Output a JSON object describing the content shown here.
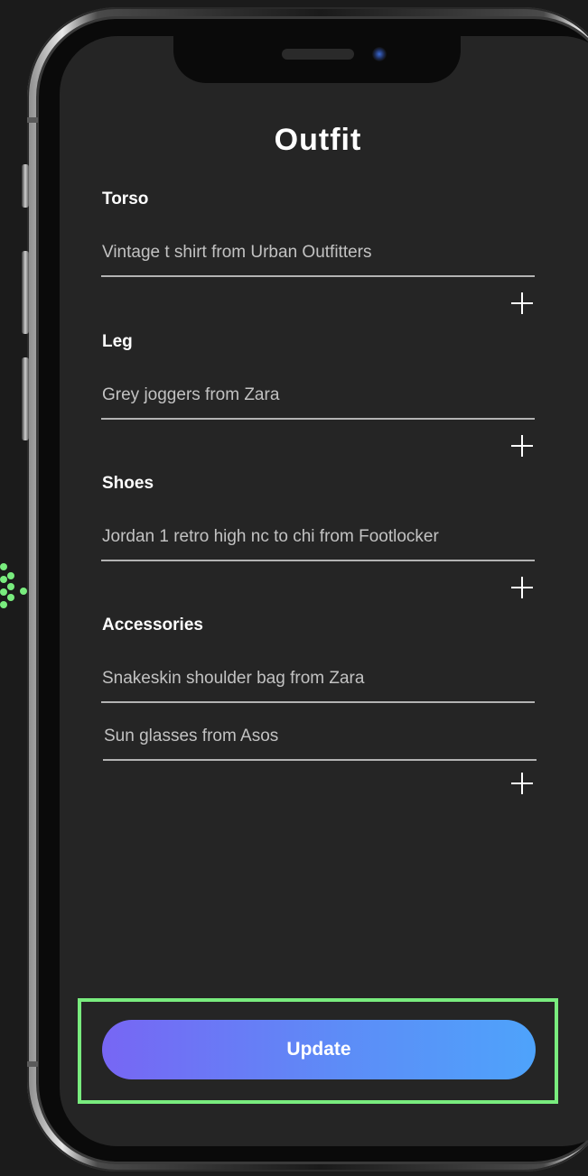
{
  "app": {
    "title": "Outfit"
  },
  "sections": [
    {
      "label": "Torso",
      "items": [
        "Vintage t shirt from Urban Outfitters"
      ]
    },
    {
      "label": "Leg",
      "items": [
        "Grey joggers from Zara"
      ]
    },
    {
      "label": "Shoes",
      "items": [
        "Jordan 1 retro high nc to chi from Footlocker"
      ]
    },
    {
      "label": "Accessories",
      "items": [
        "Snakeskin shoulder bag from Zara",
        "Sun glasses from Asos"
      ]
    }
  ],
  "actions": {
    "update_label": "Update"
  },
  "colors": {
    "screen_background": "#252525",
    "highlight": "#79ec7e",
    "button_gradient_start": "#7766f4",
    "button_gradient_end": "#4ea3fb"
  },
  "icons": [
    "plus-icon",
    "camera-icon",
    "speaker-icon"
  ]
}
